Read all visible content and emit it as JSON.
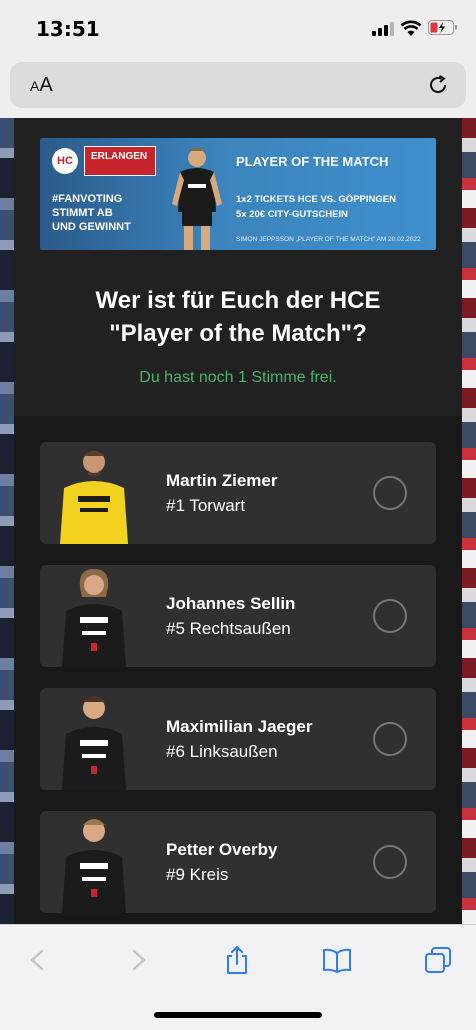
{
  "status": {
    "time": "13:51"
  },
  "browser": {
    "aa_label_small": "A",
    "aa_label_big": "A"
  },
  "banner": {
    "logo": "HC",
    "sponsor": "ERLANGEN",
    "fanvoting_line1": "#FANVOTING",
    "fanvoting_line2": "STIMMT AB",
    "fanvoting_line3": "UND GEWINNT",
    "title": "PLAYER OF THE MATCH",
    "prize1": "1x2  TICKETS HCE VS. GÖPPINGEN",
    "prize2": "5x   20€ CITY-GUTSCHEIN",
    "footer": "SIMON JEPPSSON „PLAYER OF THE MATCH“ AM 20.02.2022"
  },
  "page": {
    "headline_line1": "Wer ist für Euch der HCE",
    "headline_line2": "\"Player of the Match\"?",
    "votes_left": "Du hast noch 1 Stimme frei."
  },
  "players": [
    {
      "name": "Martin Ziemer",
      "position": "#1 Torwart",
      "jersey_color": "#f2d21e",
      "selected": false
    },
    {
      "name": "Johannes Sellin",
      "position": "#5 Rechtsaußen",
      "jersey_color": "#1b1b1b",
      "selected": false
    },
    {
      "name": "Maximilian Jaeger",
      "position": "#6 Linksaußen",
      "jersey_color": "#1b1b1b",
      "selected": false
    },
    {
      "name": "Petter Overby",
      "position": "#9 Kreis",
      "jersey_color": "#1b1b1b",
      "selected": false
    }
  ],
  "colors": {
    "accent_green": "#49b36d",
    "ios_blue": "#2f7cf6"
  }
}
